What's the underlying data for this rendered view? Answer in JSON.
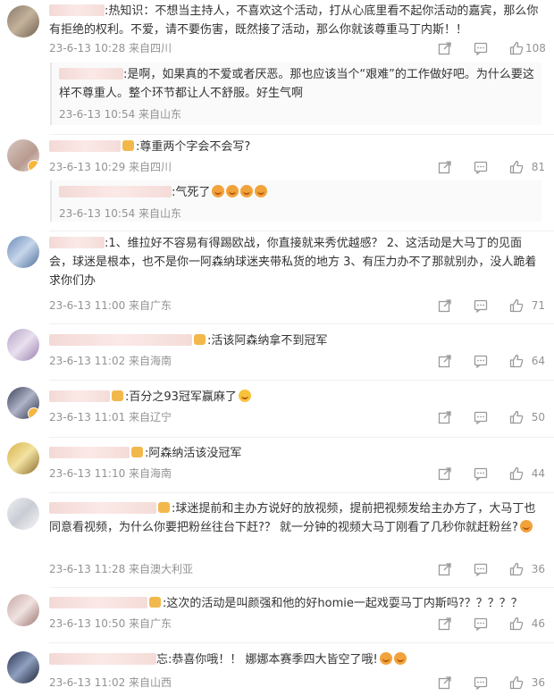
{
  "comments": [
    {
      "text": ":热知识：不想当主持人，不喜欢这个活动，打从心底里看不起你活动的嘉宾，那么你有拒绝的权利。不爱，请不要伤害，既然接了活动，那么你就该尊重马丁内斯！！",
      "time": "23-6-13 10:28 来自四川",
      "likes": "108",
      "reply": {
        "text": ":是啊，如果真的不爱或者厌恶。那也应该当个“艰难”的工作做好吧。为什么要这样不尊重人。整个环节都让人不舒服。好生气啊",
        "time": "23-6-13 10:54 来自山东"
      }
    },
    {
      "text": ":尊重两个字会不会写?",
      "time": "23-6-13 10:29 来自四川",
      "likes": "81",
      "reply": {
        "text": ":气死了",
        "time": "23-6-13 10:54 来自山东"
      }
    },
    {
      "text": ":1、维拉好不容易有得踢欧战，你直接就来秀优越感？ 2、这活动是大马丁的见面会，球迷是根本，也不是你一阿森纳球迷夹带私货的地方 3、有压力办不了那就别办，没人跪着求你们办",
      "time": "23-6-13 11:00 来自广东",
      "likes": "71"
    },
    {
      "text": ":活该阿森纳拿不到冠军",
      "time": "23-6-13 11:02 来自海南",
      "likes": "64"
    },
    {
      "text": ":百分之93冠军赢麻了",
      "time": "23-6-13 11:01 来自辽宁",
      "likes": "50"
    },
    {
      "text": ":阿森纳活该没冠军",
      "time": "23-6-13 11:10 来自海南",
      "likes": "44"
    },
    {
      "text": ":球迷提前和主办方说好的放视频，提前把视频发给主办方了，大马丁也同意看视频，为什么你要把粉丝往台下赶?？ 就一分钟的视频大马丁刚看了几秒你就赶粉丝?",
      "time": "23-6-13 11:28 来自澳大利亚",
      "likes": "36"
    },
    {
      "text": ":这次的活动是叫颜强和他的好homie一起戏耍马丁内斯吗?？？？？？",
      "time": "23-6-13 10:50 来自广东",
      "likes": "46"
    },
    {
      "text": "忘:恭喜你哦！！ 娜娜本赛季四大皆空了哦!",
      "time": "23-6-13 11:02 来自山西",
      "likes": "36"
    }
  ],
  "icons": {
    "share": "share-icon",
    "comment": "comment-icon",
    "like": "thumbs-up-icon",
    "verified": "verified-badge-icon"
  },
  "colors": {
    "meta": "#939393",
    "text": "#333333",
    "reply_bg": "#fafafa"
  }
}
